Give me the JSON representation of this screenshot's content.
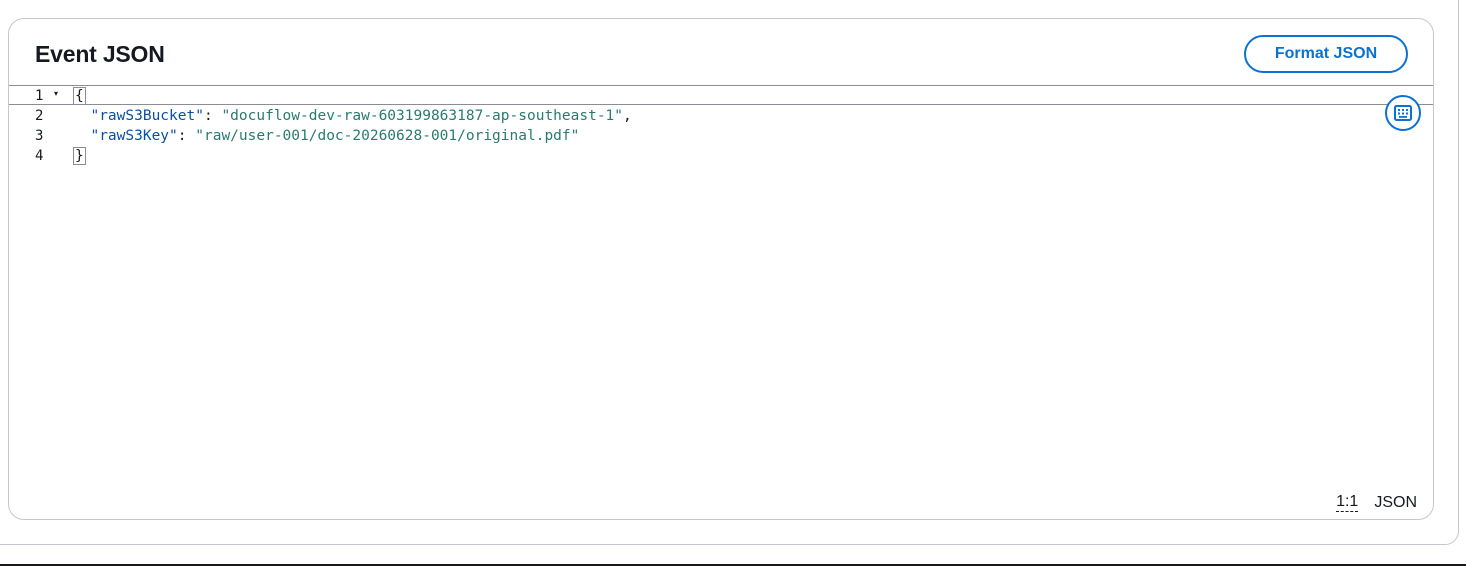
{
  "panel": {
    "title": "Event JSON",
    "format_button_label": "Format JSON"
  },
  "editor": {
    "line_numbers": [
      "1",
      "2",
      "3",
      "4"
    ],
    "open_brace": "{",
    "close_brace": "}",
    "entries": [
      {
        "key": "\"rawS3Bucket\"",
        "sep": ": ",
        "value": "\"docuflow-dev-raw-603199863187-ap-southeast-1\"",
        "trail": ","
      },
      {
        "key": "\"rawS3Key\"",
        "sep": ": ",
        "value": "\"raw/user-001/doc-20260628-001/original.pdf\"",
        "trail": ""
      }
    ],
    "fold_icon": "▾",
    "keyboard_icon": "keyboard-icon"
  },
  "status": {
    "cursor_position": "1:1",
    "language": "JSON"
  },
  "colors": {
    "accent": "#0972d3",
    "key": "#0b4fa3",
    "string": "#2a7a6f",
    "text": "#16191f",
    "border": "#c6c6cd"
  }
}
